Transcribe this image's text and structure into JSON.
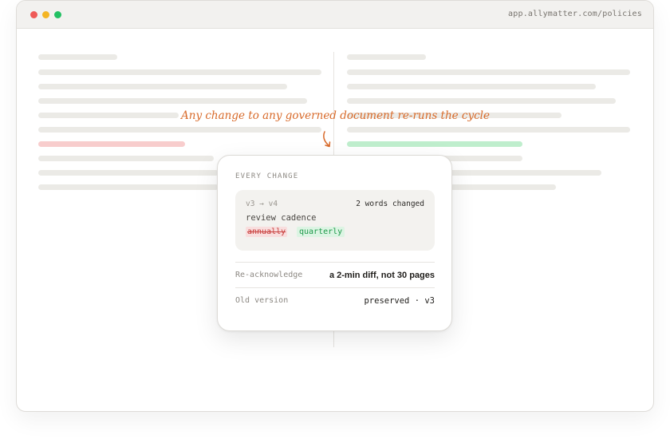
{
  "browser": {
    "url": "app.allymatter.com/policies"
  },
  "annotation": {
    "text": "Any change to any governed document re-runs the cycle",
    "color": "#d86a2a"
  },
  "card": {
    "eyebrow": "EVERY CHANGE",
    "diff": {
      "versions": "v3 → v4",
      "summary": "2 words changed",
      "field": "review cadence",
      "removed": "annually",
      "added": "quarterly"
    },
    "rows": [
      {
        "label": "Re-acknowledge",
        "value": "a 2-min diff, not 30 pages"
      },
      {
        "label": "Old version",
        "value": "preserved · v3"
      }
    ]
  },
  "colors": {
    "removed": "#c9403e",
    "added": "#1e9a4a",
    "window_red": "#ef5a57",
    "window_yellow": "#f4b524",
    "window_green": "#22c063"
  }
}
